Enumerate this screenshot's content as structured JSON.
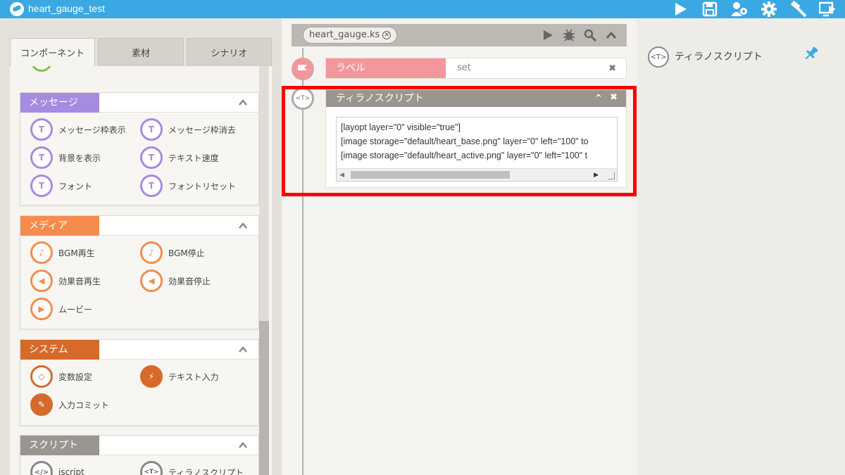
{
  "app": {
    "title": "heart_gauge_test",
    "toolbar_icons": [
      "play-icon",
      "save-icon",
      "users-icon",
      "gear-icon",
      "hammer-icon",
      "export-icon"
    ]
  },
  "left_panel": {
    "tabs": [
      {
        "label": "コンポーネント",
        "active": true
      },
      {
        "label": "素材",
        "active": false
      },
      {
        "label": "シナリオ",
        "active": false
      }
    ],
    "groups": {
      "message": {
        "title": "メッセージ",
        "color": "#a78be0",
        "items": [
          "メッセージ枠表示",
          "メッセージ枠消去",
          "背景を表示",
          "テキスト速度",
          "フォント",
          "フォントリセット"
        ]
      },
      "media": {
        "title": "メディア",
        "color": "#f58c4e",
        "items": [
          "BGM再生",
          "BGM停止",
          "効果音再生",
          "効果音停止",
          "ムービー"
        ]
      },
      "system": {
        "title": "システム",
        "color": "#d76a2a",
        "items": [
          "変数設定",
          "テキスト入力",
          "入力コミット"
        ]
      },
      "script": {
        "title": "スクリプト",
        "color": "#9a958e",
        "items": [
          "iscript",
          "ティラノスクリプト"
        ]
      }
    }
  },
  "editor": {
    "file_tab": "heart_gauge.ks",
    "file_icons": [
      "play-icon",
      "bug-icon",
      "search-icon",
      "chevron-up-icon"
    ],
    "label_block": {
      "title": "ラベル",
      "value": "set",
      "color": "#f3979d"
    },
    "script_block": {
      "title": "ティラノスクリプト",
      "lines": [
        "[layopt layer=\"0\" visible=\"true\"]",
        "[image storage=\"default/heart_base.png\" layer=\"0\" left=\"100\" to",
        "[image storage=\"default/heart_active.png\" layer=\"0\" left=\"100\" t"
      ]
    }
  },
  "right_panel": {
    "title": "ティラノスクリプト",
    "icon_text": "<T>",
    "accent": "#3aa8e2"
  }
}
